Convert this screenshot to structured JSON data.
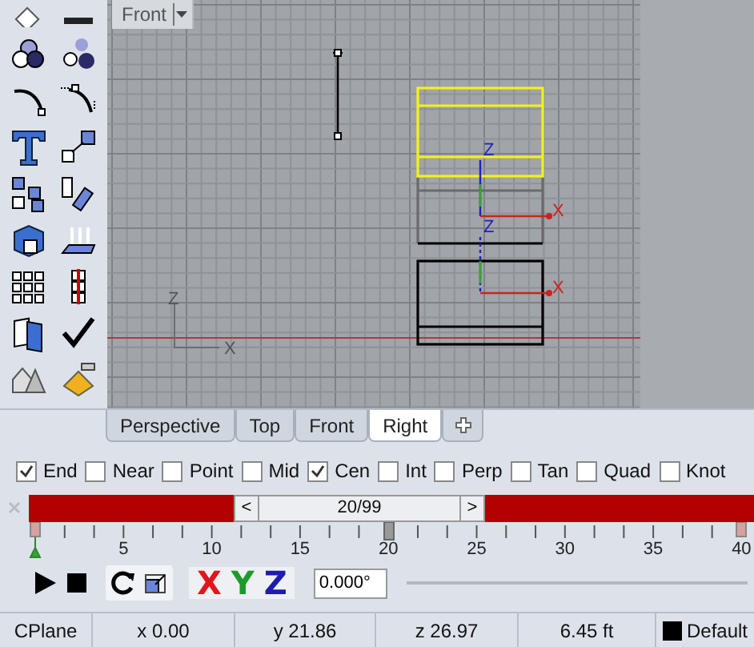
{
  "viewport": {
    "title": "Front",
    "world_axes": {
      "z": "Z",
      "x": "X"
    },
    "gumballs": [
      {
        "z": "Z",
        "x": "X"
      },
      {
        "z": "Z",
        "x": "X"
      }
    ],
    "objects": [
      {
        "kind": "line",
        "selected": false
      },
      {
        "kind": "block",
        "selected": true
      },
      {
        "kind": "block",
        "selected": false
      }
    ]
  },
  "view_tabs": [
    {
      "label": "Perspective",
      "selected": false
    },
    {
      "label": "Top",
      "selected": false
    },
    {
      "label": "Front",
      "selected": false
    },
    {
      "label": "Right",
      "selected": true
    }
  ],
  "osnaps": [
    {
      "label": "End",
      "checked": true
    },
    {
      "label": "Near",
      "checked": false
    },
    {
      "label": "Point",
      "checked": false
    },
    {
      "label": "Mid",
      "checked": false
    },
    {
      "label": "Cen",
      "checked": true
    },
    {
      "label": "Int",
      "checked": false
    },
    {
      "label": "Perp",
      "checked": false
    },
    {
      "label": "Tan",
      "checked": false
    },
    {
      "label": "Quad",
      "checked": false
    },
    {
      "label": "Knot",
      "checked": false
    }
  ],
  "timeline": {
    "prev": "<",
    "frame": "20/99",
    "next": ">",
    "tick_labels": [
      "5",
      "10",
      "15",
      "20",
      "25",
      "30",
      "35",
      "40"
    ]
  },
  "transform": {
    "axes": [
      {
        "label": "X",
        "color": "#e3141c"
      },
      {
        "label": "Y",
        "color": "#1e9a2c"
      },
      {
        "label": "Z",
        "color": "#1c1cae"
      }
    ],
    "angle": "0.000°"
  },
  "status_bar": {
    "cplane": "CPlane",
    "x": "x 0.00",
    "y": "y 21.86",
    "z": "z 26.97",
    "distance": "6.45 ft",
    "layer": "Default"
  }
}
